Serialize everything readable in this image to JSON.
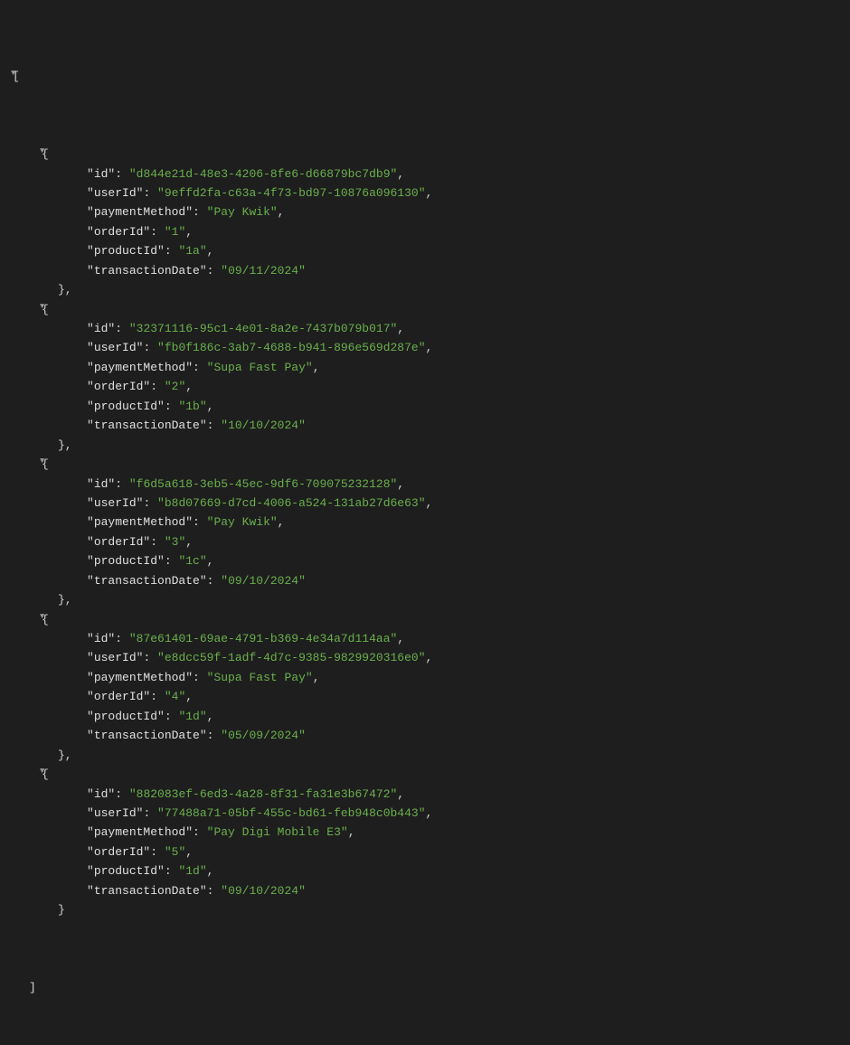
{
  "json": {
    "root_open": "[",
    "root_close": "]",
    "obj_open": "{",
    "obj_close_comma": "},",
    "obj_close": "}",
    "quote": "\"",
    "colon": ": ",
    "comma": ",",
    "keys": {
      "id": "id",
      "userId": "userId",
      "paymentMethod": "paymentMethod",
      "orderId": "orderId",
      "productId": "productId",
      "transactionDate": "transactionDate"
    },
    "items": [
      {
        "id": "d844e21d-48e3-4206-8fe6-d66879bc7db9",
        "userId": "9effd2fa-c63a-4f73-bd97-10876a096130",
        "paymentMethod": "Pay Kwik",
        "orderId": "1",
        "productId": "1a",
        "transactionDate": "09/11/2024"
      },
      {
        "id": "32371116-95c1-4e01-8a2e-7437b079b017",
        "userId": "fb0f186c-3ab7-4688-b941-896e569d287e",
        "paymentMethod": "Supa Fast Pay",
        "orderId": "2",
        "productId": "1b",
        "transactionDate": "10/10/2024"
      },
      {
        "id": "f6d5a618-3eb5-45ec-9df6-709075232128",
        "userId": "b8d07669-d7cd-4006-a524-131ab27d6e63",
        "paymentMethod": "Pay Kwik",
        "orderId": "3",
        "productId": "1c",
        "transactionDate": "09/10/2024"
      },
      {
        "id": "87e61401-69ae-4791-b369-4e34a7d114aa",
        "userId": "e8dcc59f-1adf-4d7c-9385-9829920316e0",
        "paymentMethod": "Supa Fast Pay",
        "orderId": "4",
        "productId": "1d",
        "transactionDate": "05/09/2024"
      },
      {
        "id": "882083ef-6ed3-4a28-8f31-fa31e3b67472",
        "userId": "77488a71-05bf-455c-bd61-feb948c0b443",
        "paymentMethod": "Pay Digi Mobile E3",
        "orderId": "5",
        "productId": "1d",
        "transactionDate": "09/10/2024"
      }
    ]
  }
}
